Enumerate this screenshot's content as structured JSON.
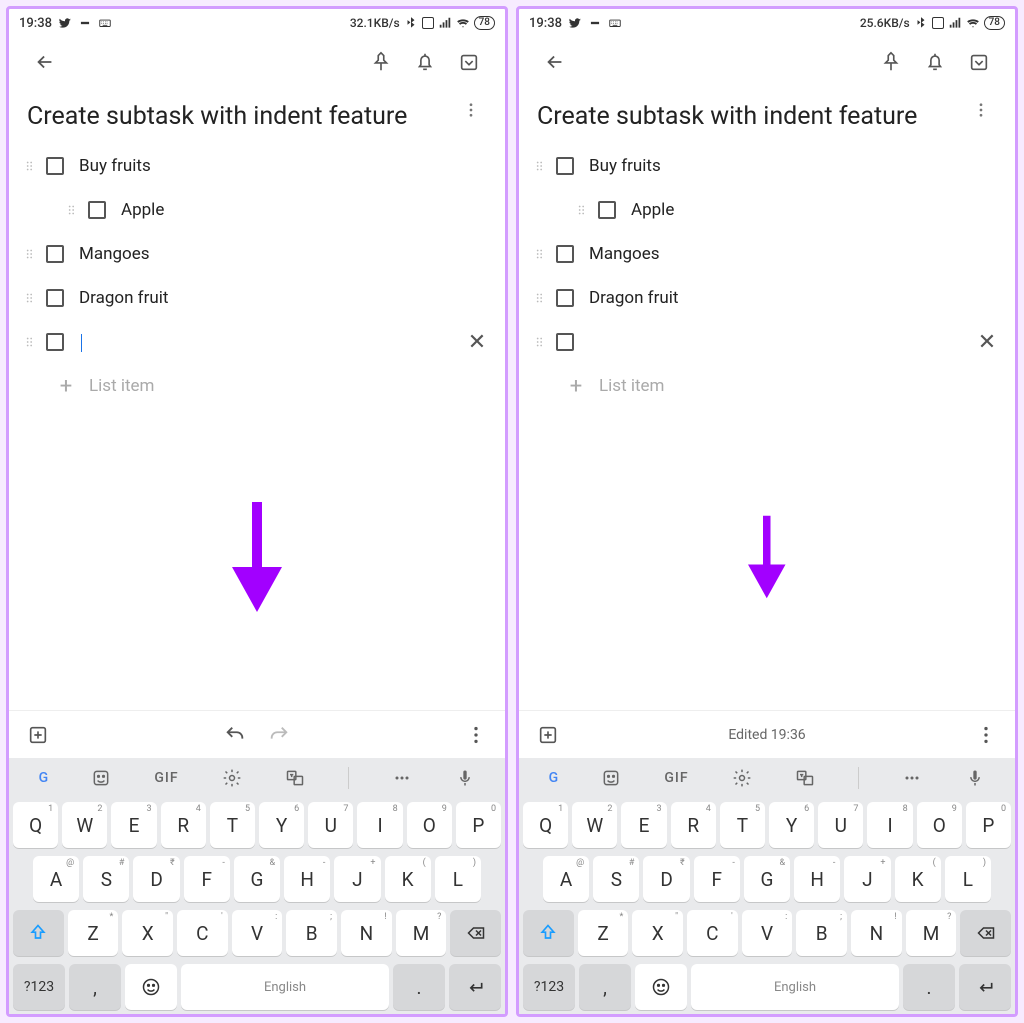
{
  "screens": [
    {
      "status": {
        "time": "19:38",
        "net": "32.1KB/s",
        "battery": "78"
      },
      "title": "Create subtask with indent feature",
      "items": [
        {
          "text": "Buy fruits",
          "indent": 0
        },
        {
          "text": "Apple",
          "indent": 1
        },
        {
          "text": "Mangoes",
          "indent": 0
        },
        {
          "text": "Dragon fruit",
          "indent": 0
        }
      ],
      "empty_item": true,
      "show_cursor": true,
      "add_placeholder": "List item",
      "bottom_mode": "undo_redo",
      "edited_text": "",
      "arrow_size": 120
    },
    {
      "status": {
        "time": "19:38",
        "net": "25.6KB/s",
        "battery": "78"
      },
      "title": "Create subtask with indent feature",
      "items": [
        {
          "text": "Buy fruits",
          "indent": 0
        },
        {
          "text": "Apple",
          "indent": 1
        },
        {
          "text": "Mangoes",
          "indent": 0
        },
        {
          "text": "Dragon fruit",
          "indent": 0
        }
      ],
      "empty_item": true,
      "show_cursor": false,
      "add_placeholder": "List item",
      "bottom_mode": "edited",
      "edited_text": "Edited 19:36",
      "arrow_size": 90
    }
  ],
  "keyboard": {
    "gif_label": "GIF",
    "row1": [
      {
        "k": "Q",
        "s": "1"
      },
      {
        "k": "W",
        "s": "2"
      },
      {
        "k": "E",
        "s": "3"
      },
      {
        "k": "R",
        "s": "4"
      },
      {
        "k": "T",
        "s": "5"
      },
      {
        "k": "Y",
        "s": "6"
      },
      {
        "k": "U",
        "s": "7"
      },
      {
        "k": "I",
        "s": "8"
      },
      {
        "k": "O",
        "s": "9"
      },
      {
        "k": "P",
        "s": "0"
      }
    ],
    "row2": [
      {
        "k": "A",
        "s": "@"
      },
      {
        "k": "S",
        "s": "#"
      },
      {
        "k": "D",
        "s": "₹"
      },
      {
        "k": "F",
        "s": "-"
      },
      {
        "k": "G",
        "s": "&"
      },
      {
        "k": "H",
        "s": "-"
      },
      {
        "k": "J",
        "s": "+"
      },
      {
        "k": "K",
        "s": "("
      },
      {
        "k": "L",
        "s": ")"
      }
    ],
    "row3": [
      {
        "k": "Z",
        "s": "*"
      },
      {
        "k": "X",
        "s": "\""
      },
      {
        "k": "C",
        "s": "'"
      },
      {
        "k": "V",
        "s": ":"
      },
      {
        "k": "B",
        "s": ";"
      },
      {
        "k": "N",
        "s": "!"
      },
      {
        "k": "M",
        "s": "?"
      }
    ],
    "sym_label": "?123",
    "comma": ",",
    "period": ".",
    "space_label": "English"
  }
}
